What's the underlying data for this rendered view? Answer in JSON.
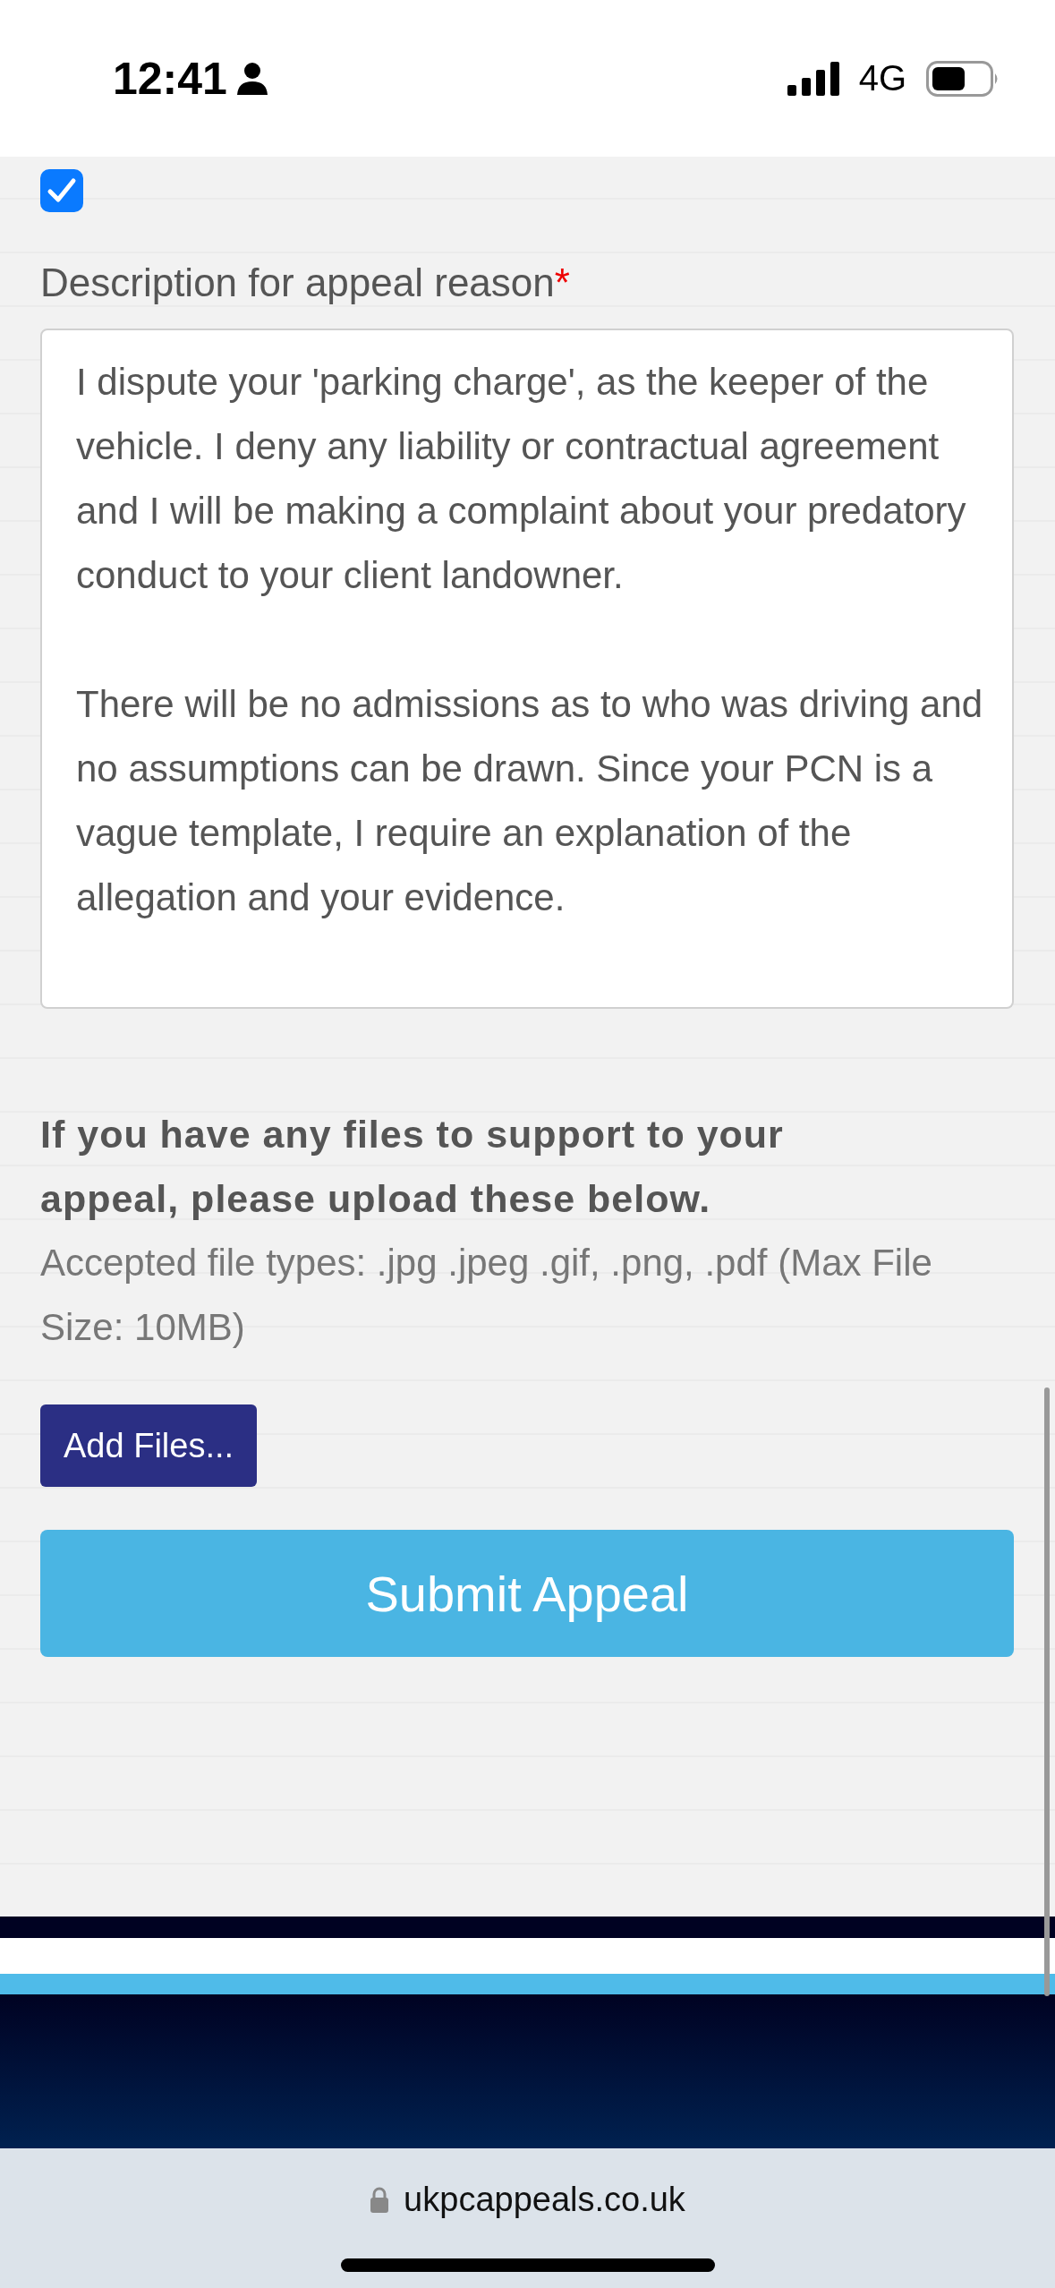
{
  "status_bar": {
    "time": "12:41",
    "network": "4G"
  },
  "consent": {
    "checked": true
  },
  "description": {
    "label": "Description for appeal reason",
    "required_mark": "*",
    "value": "I dispute your 'parking charge', as the keeper of the vehicle. I deny any liability or contractual agreement and I will be making a complaint about your predatory conduct to your client landowner.\n\nThere will be no admissions as to who was driving and no assumptions can be drawn. Since your PCN is a vague template, I require an explanation of the allegation and your evidence."
  },
  "upload": {
    "heading": "If you have any files to support to your appeal, please upload these below.",
    "hint": "Accepted file types: .jpg .jpeg .gif, .png, .pdf (Max File Size: 10MB)",
    "button": "Add Files..."
  },
  "submit_button": "Submit Appeal",
  "address_bar": {
    "url": "ukpcappeals.co.uk"
  }
}
